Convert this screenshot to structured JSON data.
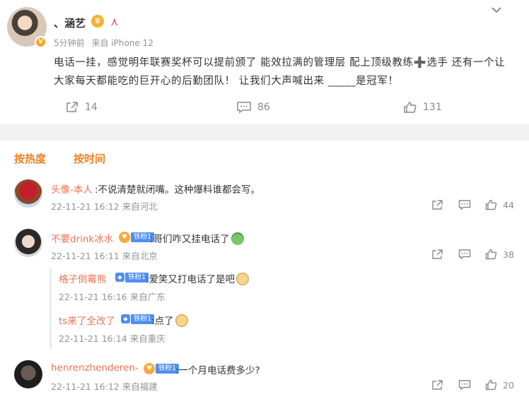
{
  "post": {
    "username": "、涵艺",
    "meta_time": "5分钟前",
    "meta_source": "来自 iPhone 12",
    "verify_badge": "V",
    "body": "电话一挂，感觉明年联赛奖杯可以提前颁了 能效拉满的管理层 配上顶级教练➕选手 还有一个让大家每天都能吃的巨开心的后勤团队！ 让我们大声喊出来 _____是冠军！",
    "repost_count": "14",
    "comment_count": "86",
    "like_count": "131"
  },
  "tabs": {
    "hot": "按热度",
    "time": "按时间"
  },
  "comments": [
    {
      "name": "头像-本人",
      "text": ":不说清楚就闭嘴。这种爆料谁都会写。",
      "meta": "22-11-21 16:12 来自河北",
      "likes": "44"
    },
    {
      "name": "不要drink冰水",
      "fan_level": "铁粉1",
      "text": ":哥们咋又挂电话了",
      "meta": "22-11-21 16:11 来自北京",
      "likes": "38",
      "replies": [
        {
          "name": "格子倒霉熊",
          "fan_level": "铁粉1",
          "text": ":爱笑又打电话了是吧",
          "meta": "22-11-21 16:16 来自广东"
        },
        {
          "name": "ts来了全改了",
          "fan_level": "铁粉1",
          "text": ":点了",
          "meta": "22-11-21 16:14 来自重庆"
        }
      ]
    },
    {
      "name": "henrenzhenderen-",
      "fan_level": "铁粉1",
      "text": ":一个月电话费多少?",
      "meta": "22-11-21 16:12 来自福建",
      "likes": "20"
    }
  ],
  "colors": {
    "accent": "#f48027",
    "name": "#eb7350",
    "meta": "#939393",
    "divider": "#f2f2f2"
  }
}
